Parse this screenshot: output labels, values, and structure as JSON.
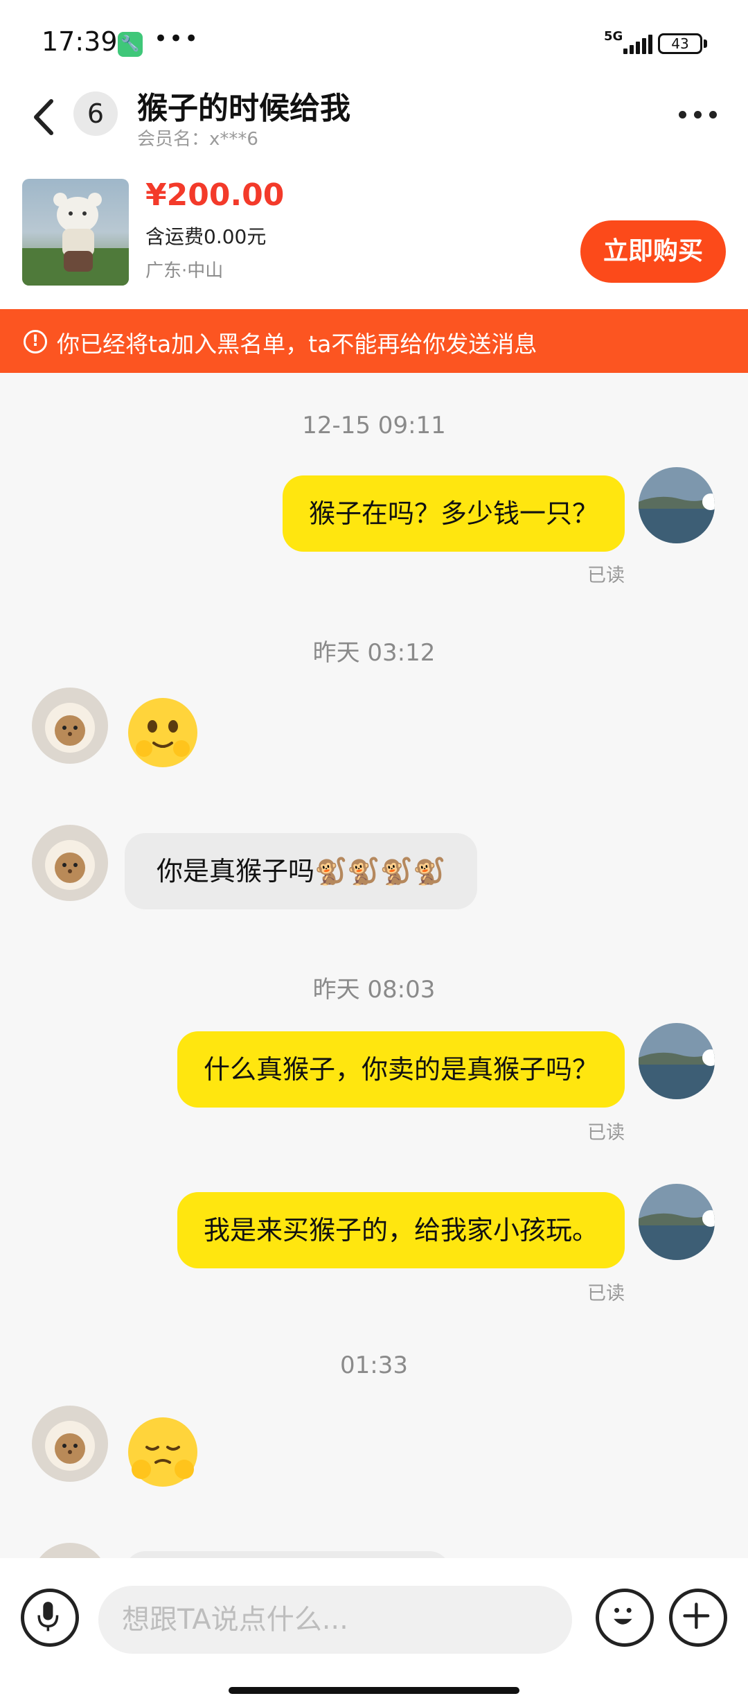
{
  "status_bar": {
    "time": "17:39",
    "network": "5G",
    "battery": "43"
  },
  "header": {
    "back_icon": "chevron-left-icon",
    "unread_count": "6",
    "title": "猴子的时候给我",
    "member_name": "会员名：x***6",
    "more_icon": "more-dots-icon"
  },
  "product": {
    "price": "¥200.00",
    "shipping": "含运费0.00元",
    "location": "广东·中山",
    "buy_label": "立即购买"
  },
  "notice": {
    "text": "你已经将ta加入黑名单，ta不能再给你发送消息",
    "icon": "warning-icon",
    "color": "#fc5521"
  },
  "messages": [
    {
      "type": "timestamp",
      "text": "12-15 09:11"
    },
    {
      "type": "sent",
      "text": "猴子在吗？多少钱一只？",
      "status": "已读"
    },
    {
      "type": "timestamp",
      "text": "昨天 03:12"
    },
    {
      "type": "received-emoji",
      "emoji": "🫣"
    },
    {
      "type": "received",
      "text": "你是真猴子吗🐒🐒🐒🐒"
    },
    {
      "type": "timestamp",
      "text": "昨天 08:03"
    },
    {
      "type": "sent",
      "text": "什么真猴子，你卖的是真猴子吗？",
      "status": "已读"
    },
    {
      "type": "sent",
      "text": "我是来买猴子的，给我家小孩玩。",
      "status": "已读"
    },
    {
      "type": "timestamp",
      "text": "01:33"
    },
    {
      "type": "received-emoji",
      "emoji": "🥺"
    }
  ],
  "input": {
    "placeholder": "想跟TA说点什么..."
  },
  "colors": {
    "accent_orange": "#fc4a1a",
    "bubble_yellow": "#ffe60f",
    "price_red": "#f33a2a"
  }
}
